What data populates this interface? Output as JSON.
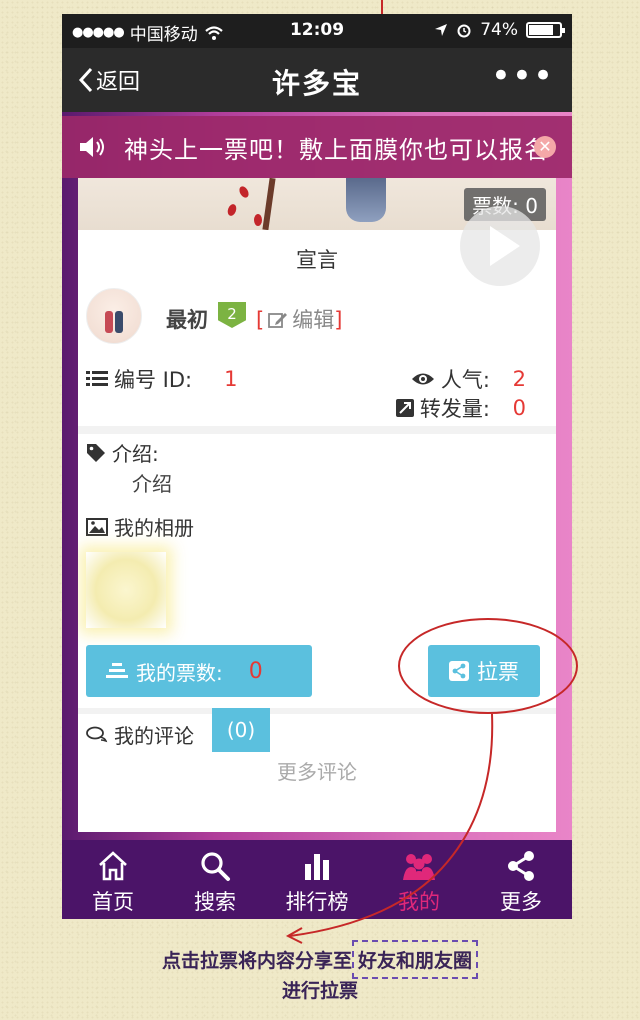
{
  "status_bar": {
    "carrier": "中国移动",
    "time": "12:09",
    "battery": "74%"
  },
  "nav": {
    "back_label": "返回",
    "title": "许多宝",
    "more_label": "•••"
  },
  "notice": {
    "text": "神头上一票吧！敷上面膜你也可以报名"
  },
  "profile": {
    "votes_badge": "票数: 0",
    "declaration_title": "宣言",
    "name": "最初",
    "level": "2",
    "edit_label": "编辑",
    "id_label": "编号 ID:",
    "id_value": "1",
    "popularity_label": "人气:",
    "popularity_value": "2",
    "shares_label": "转发量:",
    "shares_value": "0"
  },
  "intro": {
    "label": "介绍:",
    "text": "介绍"
  },
  "album": {
    "label": "我的相册"
  },
  "actions": {
    "my_votes_label": "我的票数:",
    "my_votes_value": "0",
    "canvass_label": "拉票"
  },
  "comments": {
    "label": "我的评论",
    "count": "(0)",
    "more_label": "更多评论"
  },
  "tabbar": {
    "items": [
      {
        "label": "首页",
        "icon": "home-icon"
      },
      {
        "label": "搜索",
        "icon": "search-icon"
      },
      {
        "label": "排行榜",
        "icon": "bar-chart-icon"
      },
      {
        "label": "我的",
        "icon": "people-icon",
        "active": true
      },
      {
        "label": "更多",
        "icon": "share-icon"
      }
    ]
  },
  "annotation": {
    "line1_prefix": "点击拉票将内容分享至",
    "line1_highlight": "好友和朋友圈",
    "line2": "进行拉票"
  },
  "colors": {
    "accent_blue": "#5bc0de",
    "value_red": "#e53935",
    "tab_bar": "#4b1468",
    "active_tab": "#e0287a",
    "annotation_red": "#c62828"
  }
}
